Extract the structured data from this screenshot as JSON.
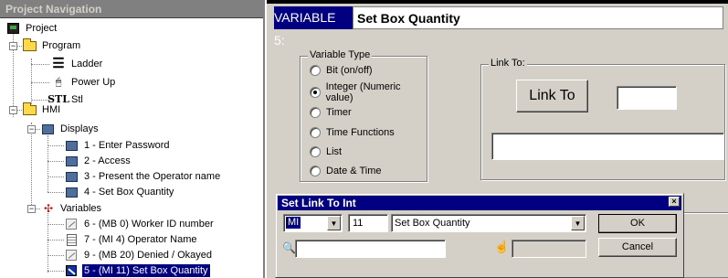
{
  "nav": {
    "title": "Project Navigation",
    "project": "Project",
    "program": "Program",
    "program_items": [
      "Ladder",
      "Power Up",
      "Stl"
    ],
    "hmi": "HMI",
    "displays": "Displays",
    "display_items": [
      "1 - Enter Password",
      "2 - Access",
      "3 - Present the Operator name",
      "4 - Set Box Quantity"
    ],
    "variables": "Variables",
    "variable_items": [
      "6 - (MB 0)  Worker ID number",
      "7 - (MI 4)  Operator Name",
      "9 - (MB 20)  Denied / Okayed",
      "5 - (MI 11)  Set Box Quantity"
    ]
  },
  "variable": {
    "number_label": "VARIABLE 5:",
    "name": "Set Box Quantity"
  },
  "variable_type": {
    "title": "Variable Type",
    "options": [
      "Bit (on/off)",
      "Integer (Numeric value)",
      "Timer",
      "Time Functions",
      "List",
      "Date & Time"
    ],
    "selected_index": 1
  },
  "link": {
    "title": "Link To:",
    "button": "Link To",
    "value": "",
    "description": ""
  },
  "dialog": {
    "title": "Set Link To Int",
    "close": "×",
    "type_value": "MI",
    "address_value": "11",
    "name_value": "Set Box Quantity",
    "ok_label": "OK",
    "cancel_label": "Cancel",
    "search_value": "",
    "hand_value": ""
  },
  "colors": {
    "title_bar": "#000080",
    "face": "#d4d0c8",
    "nav_header": "#808080",
    "selection": "#000080"
  }
}
